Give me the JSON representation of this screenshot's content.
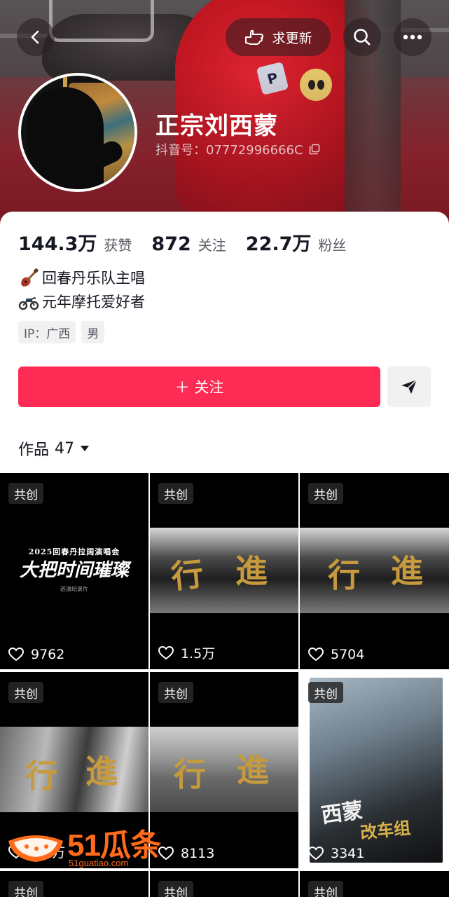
{
  "header": {
    "update_label": "求更新",
    "display_name": "正宗刘西蒙",
    "douyin_id": "抖音号：07772996666C"
  },
  "stats": [
    {
      "num": "144.3万",
      "label": "获赞"
    },
    {
      "num": "872",
      "label": "关注"
    },
    {
      "num": "22.7万",
      "label": "粉丝"
    }
  ],
  "bio": [
    {
      "emoji": "guitar-icon",
      "text": "回春丹乐队主唱"
    },
    {
      "emoji": "motorcycle-icon",
      "text": "元年摩托爱好者"
    }
  ],
  "tags": [
    "IP：广西",
    "男"
  ],
  "follow_label": "＋ 关注",
  "works": {
    "label": "作品",
    "count": "47"
  },
  "tiles": [
    {
      "badge": "共创",
      "likes": "9762"
    },
    {
      "badge": "共创",
      "likes": "1.5万"
    },
    {
      "badge": "共创",
      "likes": "5704"
    },
    {
      "badge": "共创",
      "likes": "1.9万"
    },
    {
      "badge": "共创",
      "likes": "8113"
    },
    {
      "badge": "共创",
      "likes": "3341"
    },
    {
      "badge": "共创"
    },
    {
      "badge": "共创"
    },
    {
      "badge": "共创"
    }
  ],
  "tile_art": {
    "concert_year_line": "2025回春丹拉阔演唱会",
    "concert_big": "大把时间璀璨",
    "concert_small": "巡演纪录片",
    "xing": "行",
    "jin": "進",
    "poster_name": "西蒙",
    "poster_sub": "改车组"
  },
  "watermark": {
    "brand": "51瓜条",
    "url": "51guatiao.com"
  },
  "colors": {
    "accent": "#fe2c55",
    "watermark": "#ff6b1a",
    "gold": "#c79a3d"
  }
}
